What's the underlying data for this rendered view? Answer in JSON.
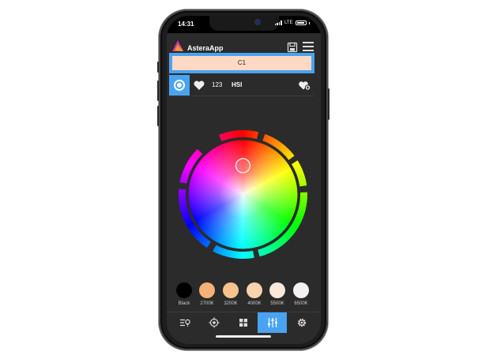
{
  "status_bar": {
    "time": "14:31",
    "network": "LTE"
  },
  "app": {
    "title": "AsteraApp"
  },
  "header_icons": [
    "save-icon",
    "menu-icon"
  ],
  "channel": {
    "label": "C1",
    "color": "#ffd9c4"
  },
  "tabs": [
    {
      "id": "wheel",
      "icon": "color-wheel-icon",
      "active": true
    },
    {
      "id": "favorites",
      "icon": "heart-icon"
    },
    {
      "id": "numeric",
      "label": "123"
    },
    {
      "id": "hsi",
      "label": "HSI"
    },
    {
      "id": "add-favorite",
      "icon": "heart-add-icon"
    }
  ],
  "swatches": [
    {
      "label": "Black",
      "color": "#000000"
    },
    {
      "label": "2700K",
      "color": "#f4b277"
    },
    {
      "label": "3200K",
      "color": "#f7c28d"
    },
    {
      "label": "4000K",
      "color": "#f8d3ae"
    },
    {
      "label": "5500K",
      "color": "#fae8db"
    },
    {
      "label": "6500K",
      "color": "#f4f1f0"
    }
  ],
  "bottom_nav": [
    {
      "icon": "list-bulb-icon",
      "active": false
    },
    {
      "icon": "target-icon",
      "active": false
    },
    {
      "icon": "grid-icon",
      "active": false
    },
    {
      "icon": "sliders-icon",
      "active": true
    },
    {
      "icon": "settings-gear-icon",
      "active": false
    }
  ],
  "accent_color": "#4aa3f0"
}
